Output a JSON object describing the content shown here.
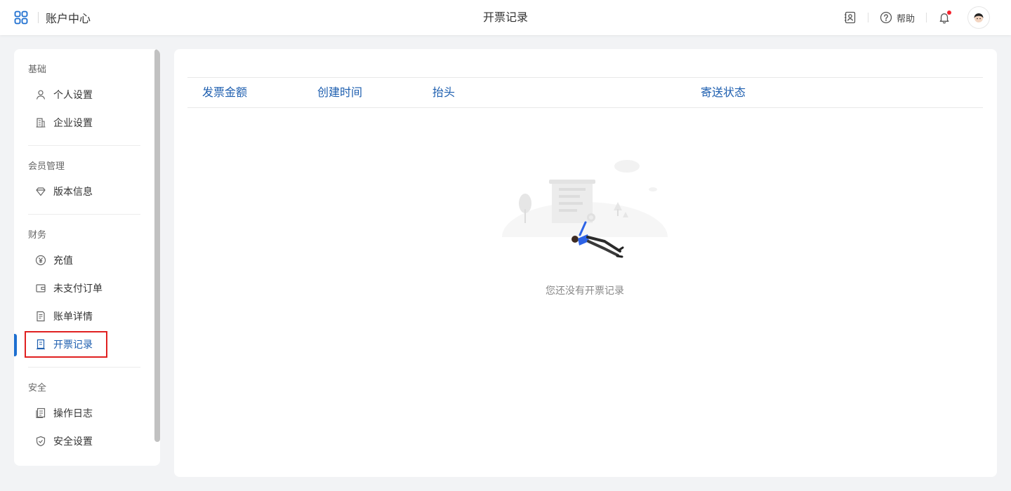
{
  "header": {
    "app_title": "账户中心",
    "page_title": "开票记录",
    "help_label": "帮助",
    "brand_color": "#1d6fd0",
    "icons": [
      "apps-grid-icon",
      "contacts-icon",
      "help-circle-icon",
      "bell-icon",
      "avatar"
    ]
  },
  "sidebar": {
    "groups": [
      {
        "title": "基础",
        "items": [
          {
            "label": "个人设置",
            "icon": "user-icon"
          },
          {
            "label": "企业设置",
            "icon": "building-icon"
          }
        ]
      },
      {
        "title": "会员管理",
        "items": [
          {
            "label": "版本信息",
            "icon": "diamond-icon"
          }
        ]
      },
      {
        "title": "财务",
        "items": [
          {
            "label": "充值",
            "icon": "yuan-icon"
          },
          {
            "label": "未支付订单",
            "icon": "wallet-icon"
          },
          {
            "label": "账单详情",
            "icon": "bill-icon"
          },
          {
            "label": "开票记录",
            "icon": "invoice-icon",
            "active": true
          }
        ]
      },
      {
        "title": "安全",
        "items": [
          {
            "label": "操作日志",
            "icon": "log-icon"
          },
          {
            "label": "安全设置",
            "icon": "shield-icon"
          }
        ]
      }
    ]
  },
  "main": {
    "columns": [
      "发票金额",
      "创建时间",
      "抬头",
      "寄送状态"
    ],
    "empty_text": "您还没有开票记录",
    "accent_color": "#1d5eaf"
  }
}
